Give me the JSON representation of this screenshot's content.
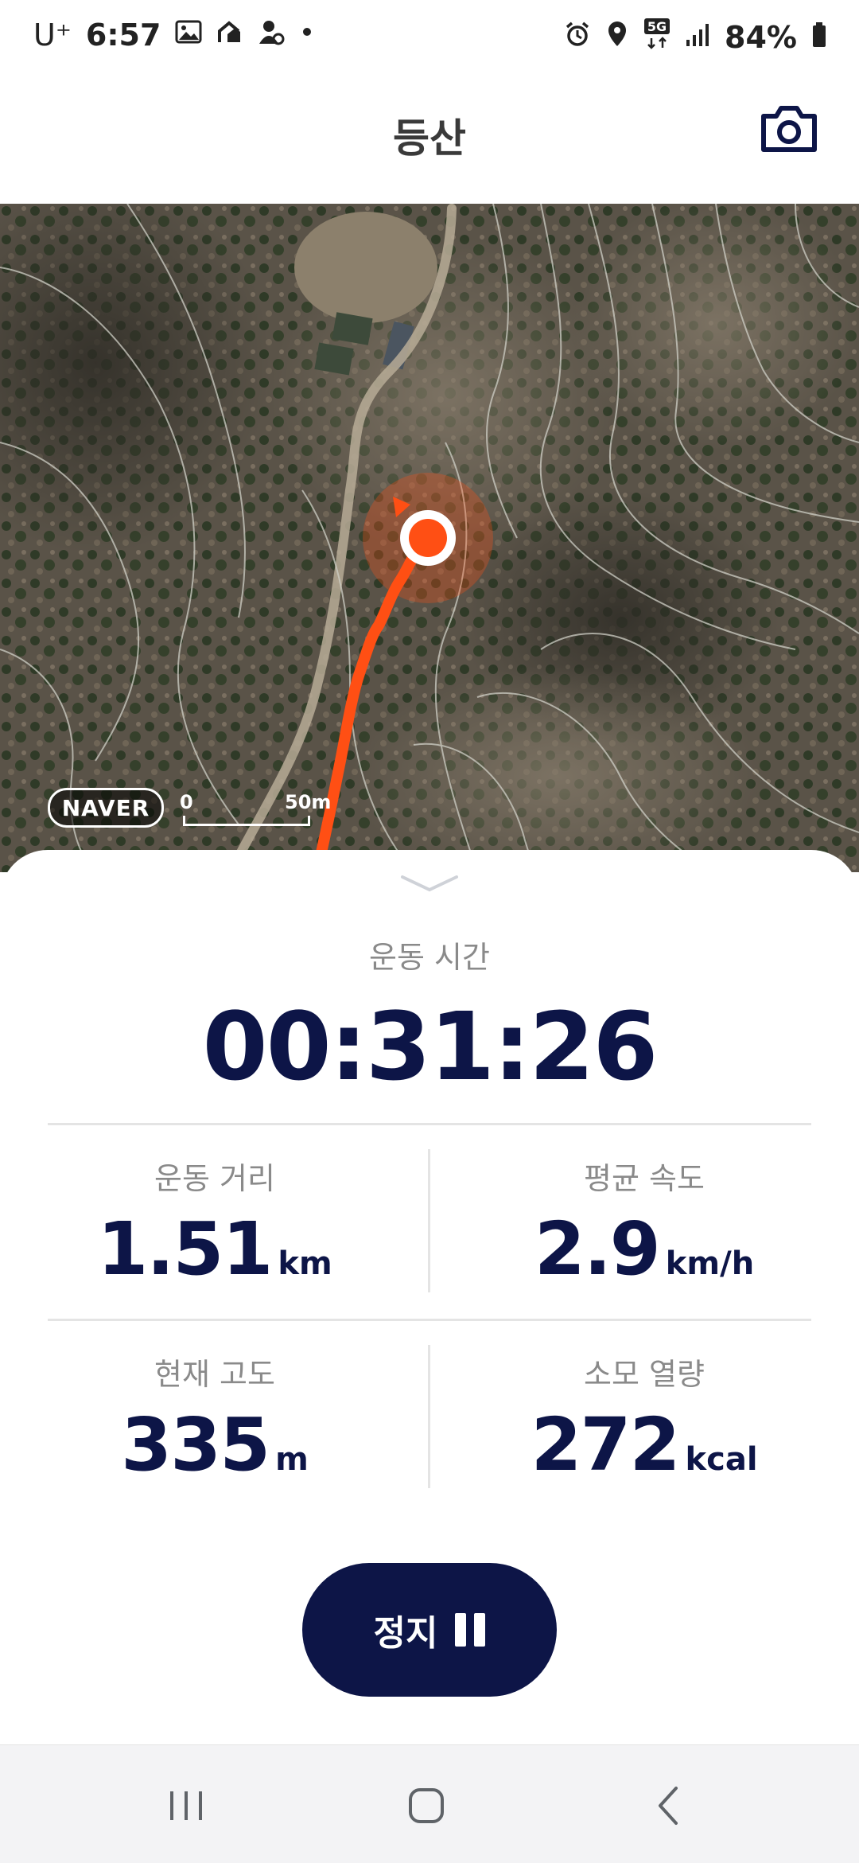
{
  "status_bar": {
    "carrier": "U⁺",
    "time": "6:57",
    "network": "5G",
    "battery": "84%",
    "left_icons": [
      "gallery-icon",
      "sync-icon",
      "location-person-icon",
      "notification-dot-icon"
    ],
    "right_icons": [
      "alarm-icon",
      "location-icon",
      "5g-icon",
      "signal-icon",
      "battery-icon"
    ]
  },
  "header": {
    "title": "등산",
    "camera_icon": "camera-icon"
  },
  "map": {
    "provider_logo": "NAVER",
    "scale_start": "0",
    "scale_end": "50m",
    "route_color": "#ff4f14",
    "position_color": "#ff4f14"
  },
  "workout": {
    "elapsed_label": "운동 시간",
    "elapsed_value": "00:31:26",
    "stats": {
      "distance": {
        "label": "운동 거리",
        "value": "1.51",
        "unit": "km"
      },
      "avg_speed": {
        "label": "평균 속도",
        "value": "2.9",
        "unit": "km/h"
      },
      "altitude": {
        "label": "현재 고도",
        "value": "335",
        "unit": "m"
      },
      "calories": {
        "label": "소모 열량",
        "value": "272",
        "unit": "kcal"
      }
    },
    "pause_button_label": "정지"
  },
  "navigation": {
    "icons": [
      "recent-apps-icon",
      "home-icon",
      "back-icon"
    ]
  },
  "colors": {
    "primary": "#0d1547",
    "accent": "#ff4f14",
    "label": "#8a8a8a"
  }
}
